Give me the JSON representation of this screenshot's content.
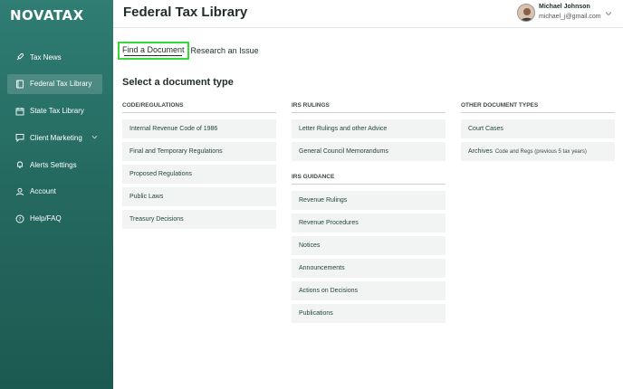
{
  "app": {
    "logo": "NOVATAX"
  },
  "sidebar": {
    "items": [
      {
        "label": "Tax News",
        "icon": "rocket-icon"
      },
      {
        "label": "Federal Tax Library",
        "icon": "book-icon",
        "active": true
      },
      {
        "label": "State Tax Library",
        "icon": "calendar-icon"
      },
      {
        "label": "Client Marketing",
        "icon": "chat-icon",
        "has_chevron": true
      },
      {
        "label": "Alerts Settings",
        "icon": "bell-icon"
      },
      {
        "label": "Account",
        "icon": "user-icon"
      },
      {
        "label": "Help/FAQ",
        "icon": "help-icon"
      }
    ]
  },
  "header": {
    "title": "Federal Tax Library",
    "user": {
      "name": "Michael Johnson",
      "email": "michael_j@gmail.com"
    }
  },
  "tabs": [
    {
      "label": "Find a Document",
      "active": true
    },
    {
      "label": "Research an Issue",
      "active": false
    }
  ],
  "main": {
    "section_title": "Select a document type",
    "columns": {
      "code_regulations": {
        "heading": "CODE/REGULATIONS",
        "items": [
          "Internal Revenue Code of 1986",
          "Final and Temporary Regulations",
          "Proposed Regulations",
          "Public Laws",
          "Treasury Decisions"
        ]
      },
      "irs_rulings": {
        "heading": "IRS RULINGS",
        "items": [
          "Letter Rulings and other Advice",
          "General Council Memorandums"
        ]
      },
      "irs_guidance": {
        "heading": "IRS GUIDANCE",
        "items": [
          "Revenue Rulings",
          "Revenue Procedures",
          "Notices",
          "Announcements",
          "Actions on Decisions",
          "Publications"
        ]
      },
      "other": {
        "heading": "OTHER DOCUMENT TYPES",
        "items": [
          {
            "label": "Court Cases",
            "sub": ""
          },
          {
            "label": "Archives",
            "sub": "Code and Regs (previous 5 tax years)"
          }
        ]
      }
    }
  },
  "colors": {
    "sidebar": "#256a61",
    "active_tab_outline": "#39d839",
    "item_bg": "#f2f3f3"
  }
}
